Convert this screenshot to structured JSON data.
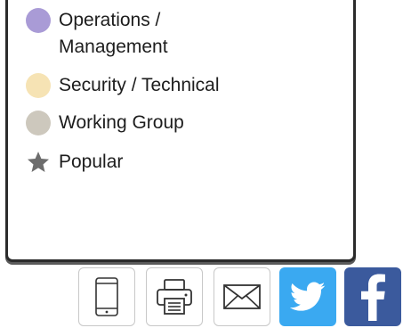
{
  "legend": {
    "items": [
      {
        "label": "Operations / Management",
        "line1": "Operations /",
        "line2": "Management",
        "color": "#a99bd6",
        "icon": "circle-swatch"
      },
      {
        "label": "Security / Technical",
        "color": "#f6e3b4",
        "icon": "circle-swatch"
      },
      {
        "label": "Working Group",
        "color": "#cdc8bd",
        "icon": "circle-swatch"
      },
      {
        "label": "Popular",
        "color": "#6d6d6d",
        "icon": "star-icon"
      }
    ]
  },
  "share": {
    "buttons": [
      {
        "name": "mobile",
        "icon": "mobile-phone-icon"
      },
      {
        "name": "print",
        "icon": "printer-icon"
      },
      {
        "name": "email",
        "icon": "envelope-icon"
      },
      {
        "name": "twitter",
        "icon": "twitter-bird-icon",
        "color": "#3aa9f1"
      },
      {
        "name": "facebook",
        "icon": "facebook-f-icon",
        "color": "#3b5a9d"
      }
    ]
  }
}
